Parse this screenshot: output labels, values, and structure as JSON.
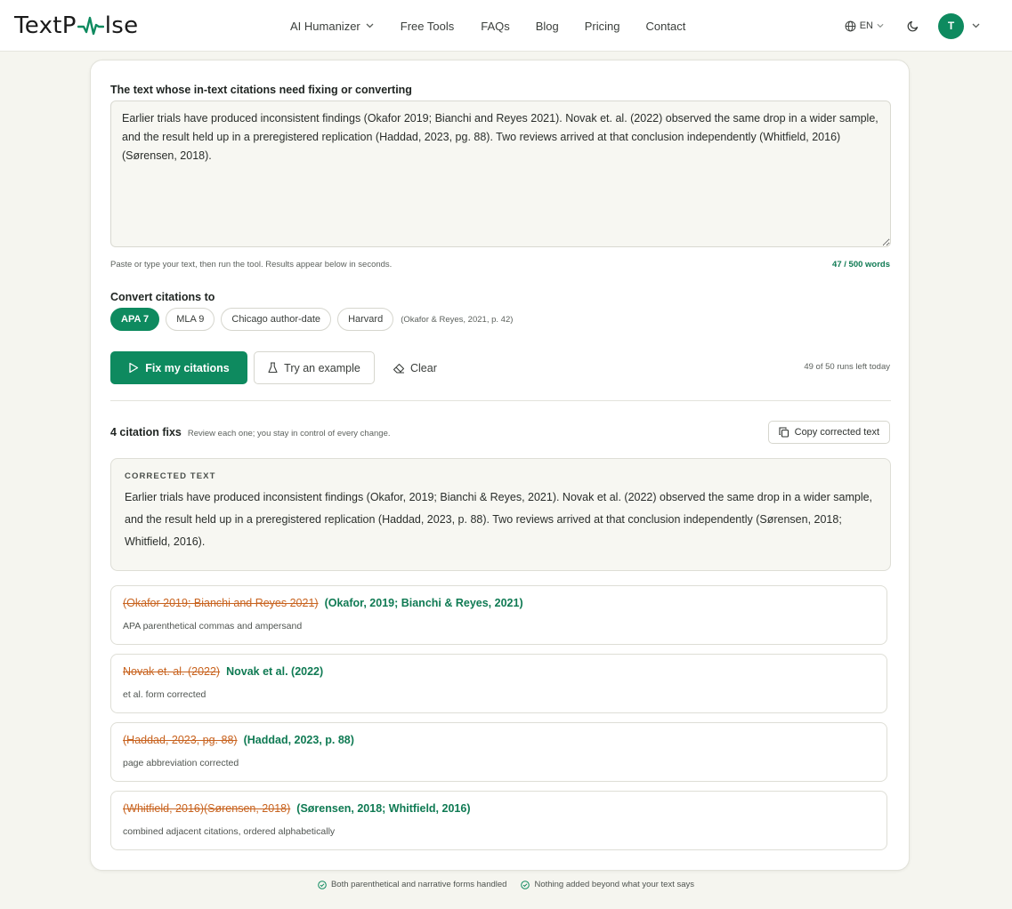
{
  "brand": {
    "logo_left": "TextP",
    "logo_right": "lse",
    "accent": "#0e8a5f"
  },
  "nav": {
    "items": [
      {
        "label": "AI Humanizer",
        "has_dropdown": true
      },
      {
        "label": "Free Tools",
        "has_dropdown": false
      },
      {
        "label": "FAQs",
        "has_dropdown": false
      },
      {
        "label": "Blog",
        "has_dropdown": false
      },
      {
        "label": "Pricing",
        "has_dropdown": false
      },
      {
        "label": "Contact",
        "has_dropdown": false
      }
    ],
    "language": "EN",
    "avatar_initial": "T"
  },
  "input": {
    "label": "The text whose in-text citations need fixing or converting",
    "value": "Earlier trials have produced inconsistent findings (Okafor 2019; Bianchi and Reyes 2021). Novak et. al. (2022) observed the same drop in a wider sample, and the result held up in a preregistered replication (Haddad, 2023, pg. 88). Two reviews arrived at that conclusion independently (Whitfield, 2016)(Sørensen, 2018).",
    "hint": "Paste or type your text, then run the tool. Results appear below in seconds.",
    "word_count": "47 / 500 words"
  },
  "convert": {
    "label": "Convert citations to",
    "styles": [
      "APA 7",
      "MLA 9",
      "Chicago author-date",
      "Harvard"
    ],
    "selected": "APA 7",
    "example": "(Okafor & Reyes, 2021, p. 42)"
  },
  "actions": {
    "primary": "Fix my citations",
    "example": "Try an example",
    "clear": "Clear",
    "runs_left": "49 of 50 runs left today"
  },
  "results": {
    "count": "4 citation fixs",
    "subtitle": "Review each one; you stay in control of every change.",
    "copy_label": "Copy corrected text",
    "corrected_label": "CORRECTED TEXT",
    "corrected_text": "Earlier trials have produced inconsistent findings (Okafor, 2019; Bianchi & Reyes, 2021). Novak et al. (2022) observed the same drop in a wider sample, and the result held up in a preregistered replication (Haddad, 2023, p. 88). Two reviews arrived at that conclusion independently (Sørensen, 2018; Whitfield, 2016).",
    "fixes": [
      {
        "old": "(Okafor 2019; Bianchi and Reyes 2021)",
        "new": "(Okafor, 2019; Bianchi & Reyes, 2021)",
        "note": "APA parenthetical commas and ampersand"
      },
      {
        "old": "Novak et. al. (2022)",
        "new": "Novak et al. (2022)",
        "note": "et al. form corrected"
      },
      {
        "old": "(Haddad, 2023, pg. 88)",
        "new": "(Haddad, 2023, p. 88)",
        "note": "page abbreviation corrected"
      },
      {
        "old": "(Whitfield, 2016)(Sørensen, 2018)",
        "new": "(Sørensen, 2018; Whitfield, 2016)",
        "note": "combined adjacent citations, ordered alphabetically"
      }
    ]
  },
  "footer": {
    "items": [
      "Both parenthetical and narrative forms handled",
      "Nothing added beyond what your text says"
    ]
  },
  "colors": {
    "old_citation": "#c8631f",
    "new_citation": "#0f7a53",
    "page_bg": "#f5f5ef"
  }
}
